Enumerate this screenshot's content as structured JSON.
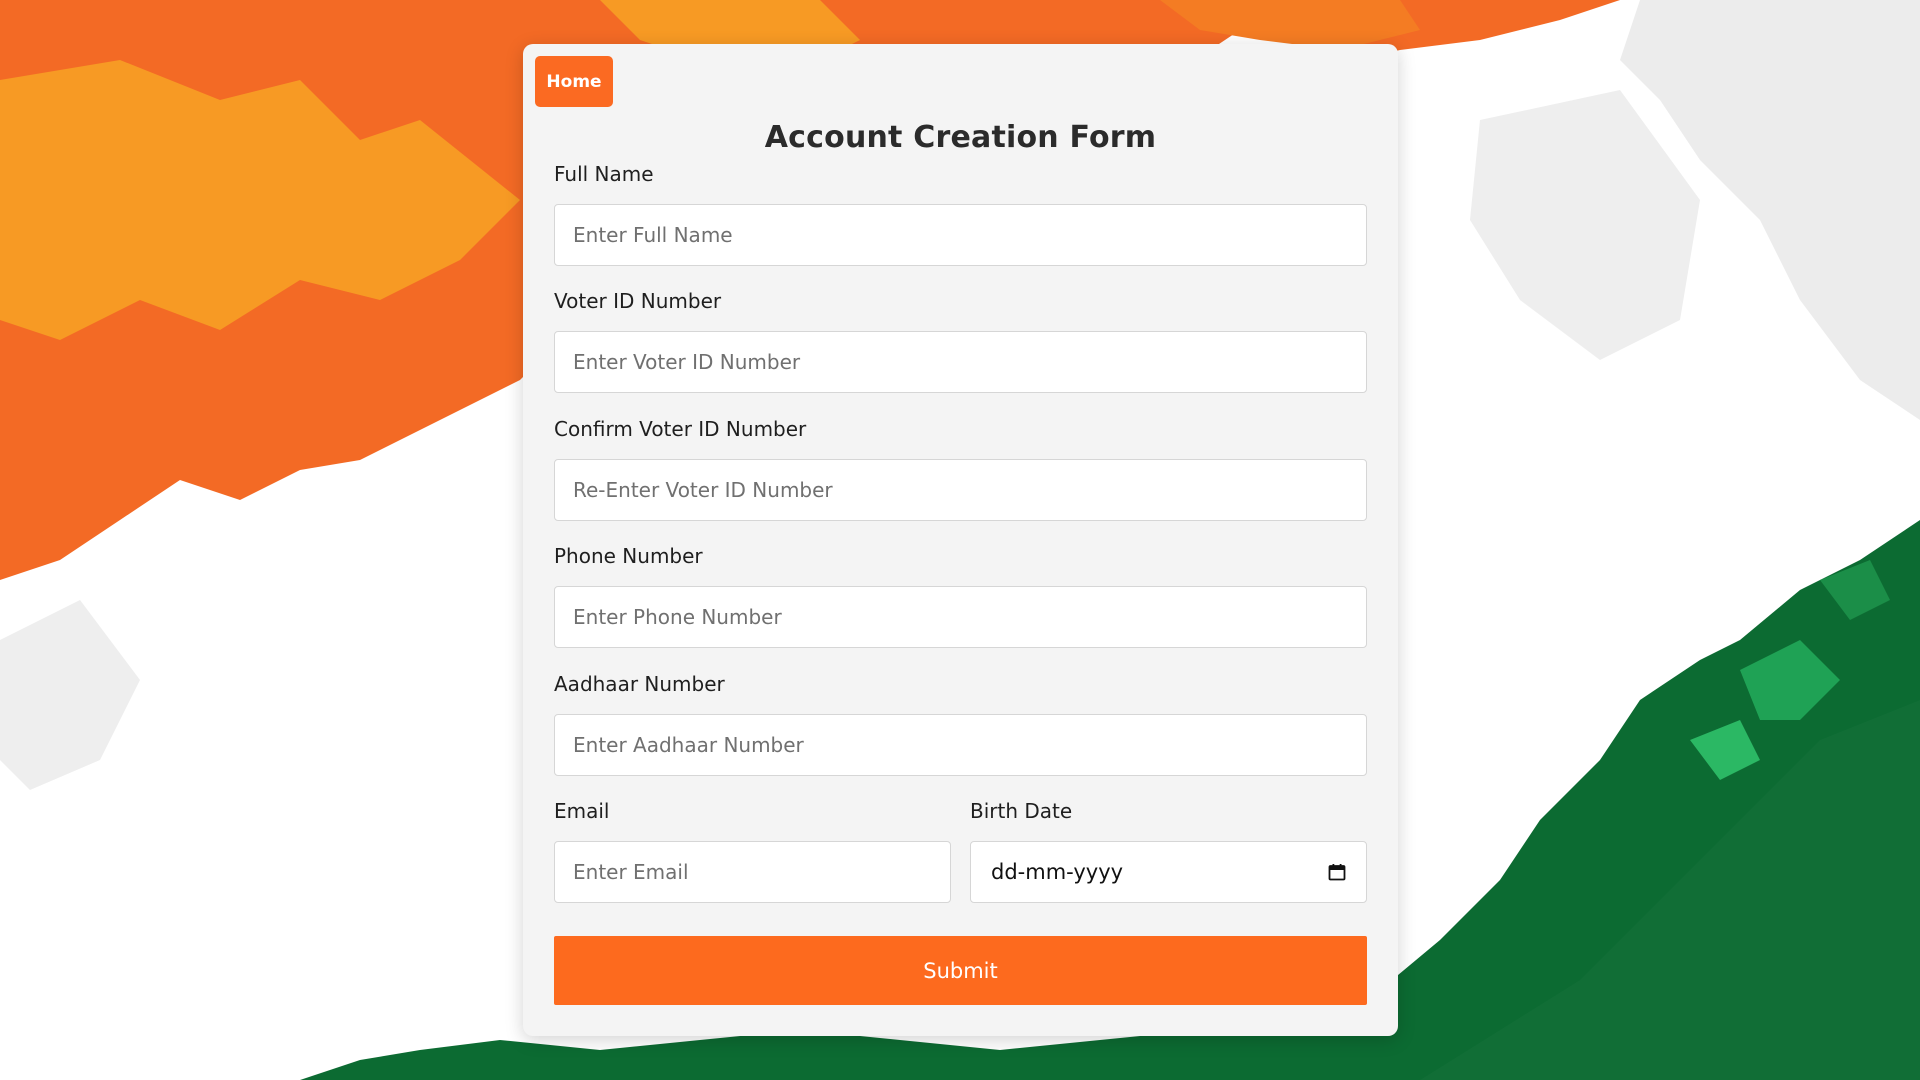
{
  "home_button": "Home",
  "title": "Account Creation Form",
  "fields": [
    {
      "label": "Full Name",
      "placeholder": "Enter Full Name"
    },
    {
      "label": "Voter ID Number",
      "placeholder": "Enter Voter ID Number"
    },
    {
      "label": "Confirm Voter ID Number",
      "placeholder": "Re-Enter Voter ID Number"
    },
    {
      "label": "Phone Number",
      "placeholder": "Enter Phone Number"
    },
    {
      "label": "Aadhaar Number",
      "placeholder": "Enter Aadhaar Number"
    }
  ],
  "email": {
    "label": "Email",
    "placeholder": "Enter Email"
  },
  "birth_date": {
    "label": "Birth Date",
    "value": "dd-mm-yyyy"
  },
  "submit_label": "Submit",
  "icons": {
    "date_picker": "calendar-icon"
  },
  "colors": {
    "accent": "#fb6a22",
    "saffron": "#f36a25",
    "saffron_light": "#f79a24",
    "green_dark": "#0c6b32",
    "green_light": "#1fa255",
    "card_bg": "#f4f4f4"
  }
}
